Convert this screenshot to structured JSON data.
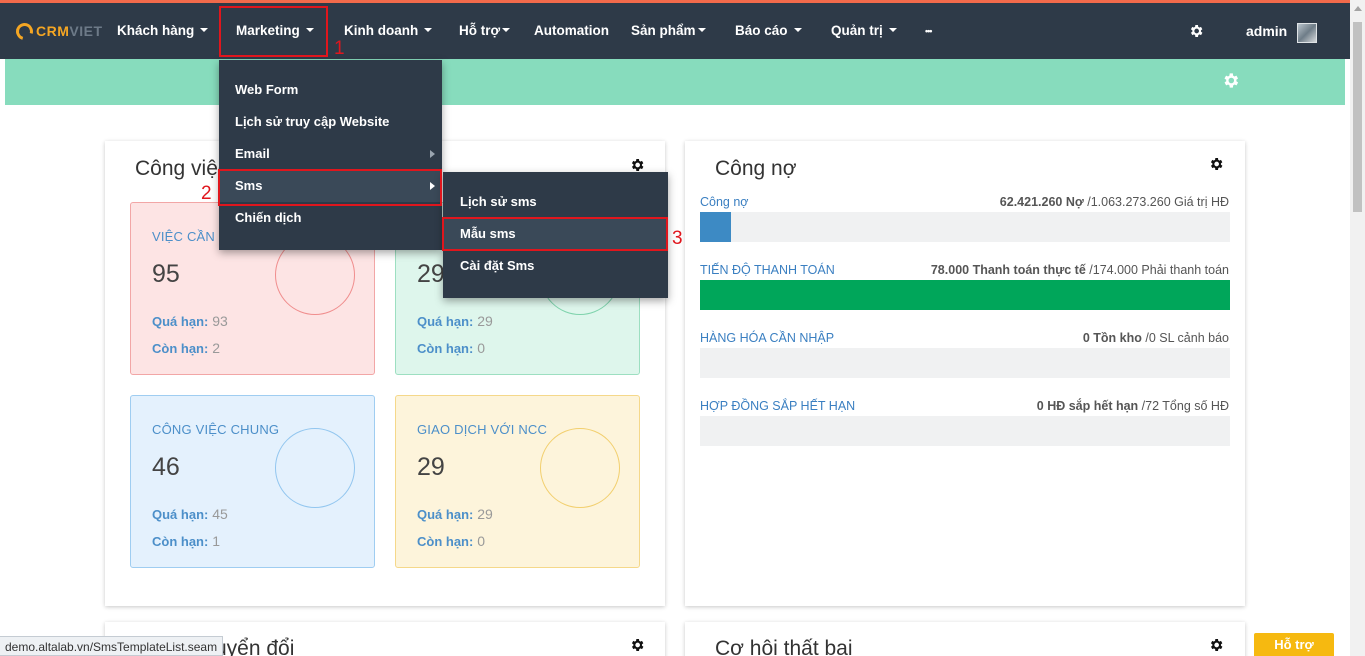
{
  "navbar": {
    "logo": {
      "part1": "CRM",
      "part2": "VIET"
    },
    "items": [
      {
        "label": "Khách hàng",
        "has_caret": true
      },
      {
        "label": "Marketing",
        "has_caret": true
      },
      {
        "label": "Kinh doanh",
        "has_caret": true
      },
      {
        "label": "Hỗ trợ",
        "has_caret": true
      },
      {
        "label": "Automation",
        "has_caret": false
      },
      {
        "label": "Sản phẩm",
        "has_caret": true
      },
      {
        "label": "Báo cáo",
        "has_caret": true
      },
      {
        "label": "Quản trị",
        "has_caret": true
      },
      {
        "label": "•••",
        "has_caret": false
      }
    ],
    "user": "admin"
  },
  "marketing_menu": {
    "items": [
      {
        "label": "Web Form",
        "submenu": false
      },
      {
        "label": "Lịch sử truy cập Website",
        "submenu": false
      },
      {
        "label": "Email",
        "submenu": true
      },
      {
        "label": "Sms",
        "submenu": true
      },
      {
        "label": "Chiến dịch",
        "submenu": false
      }
    ]
  },
  "sms_submenu": {
    "items": [
      {
        "label": "Lịch sử sms"
      },
      {
        "label": "Mẫu sms"
      },
      {
        "label": "Cài đặt Sms"
      }
    ]
  },
  "annotations": [
    "1",
    "2",
    "3"
  ],
  "work_panel": {
    "title": "Công việc",
    "cards": [
      {
        "label": "VIỆC CẦN LÀM",
        "value": "95",
        "overdue_label": "Quá hạn:",
        "overdue": "93",
        "remaining_label": "Còn hạn:",
        "remaining": "2"
      },
      {
        "label": "",
        "value": "29",
        "overdue_label": "Quá hạn:",
        "overdue": "29",
        "remaining_label": "Còn hạn:",
        "remaining": "0"
      },
      {
        "label": "CÔNG VIỆC CHUNG",
        "value": "46",
        "overdue_label": "Quá hạn:",
        "overdue": "45",
        "remaining_label": "Còn hạn:",
        "remaining": "1"
      },
      {
        "label": "GIAO DỊCH VỚI NCC",
        "value": "29",
        "overdue_label": "Quá hạn:",
        "overdue": "29",
        "remaining_label": "Còn hạn:",
        "remaining": "0"
      }
    ]
  },
  "debt_panel": {
    "title": "Công nợ",
    "rows": [
      {
        "label": "Công nợ",
        "value": "62.421.260",
        "value_label": "Nợ",
        "total": "/1.063.273.260 Giá trị HĐ",
        "fill": 0.059,
        "color": "#3d8ac4"
      },
      {
        "label": "TIẾN ĐỘ THANH TOÁN",
        "value": "78.000",
        "value_label": "Thanh toán thực tế",
        "total": "/174.000 Phải thanh toán",
        "fill": 1.0,
        "color": "#00a65a"
      },
      {
        "label": "HÀNG HÓA CẦN NHẬP",
        "value": "0",
        "value_label": "Tồn kho",
        "total": "/0 SL cảnh báo",
        "fill": 0,
        "color": "#3d8ac4"
      },
      {
        "label": "HỢP ĐỒNG SẮP HẾT HẠN",
        "value": "0",
        "value_label": "HĐ sắp hết hạn",
        "total": "/72 Tổng số HĐ",
        "fill": 0,
        "color": "#3d8ac4"
      }
    ]
  },
  "bottom_panels": {
    "left_title": "uyển đổi",
    "right_title": "Cơ hội thất bại"
  },
  "status_url": "demo.altalab.vn/SmsTemplateList.seam",
  "help_button": "Hỗ trợ"
}
